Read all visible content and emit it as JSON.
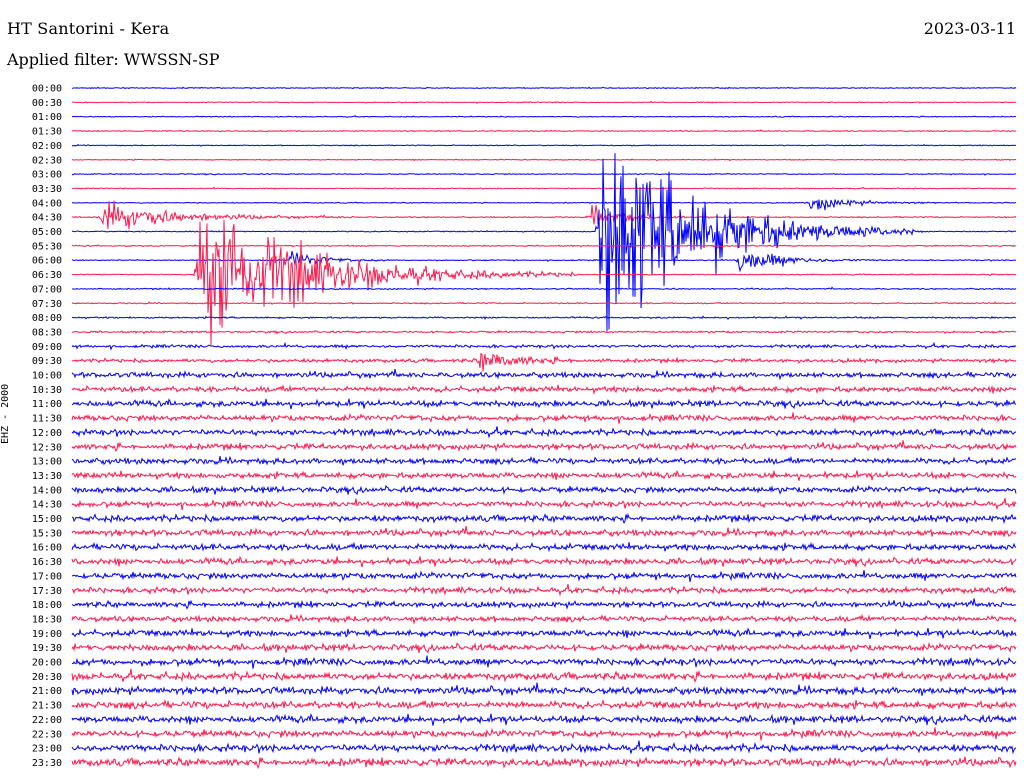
{
  "header": {
    "title": "HT Santorini - Kera",
    "date": "2023-03-11",
    "filter": "Applied filter: WWSSN-SP",
    "channel": "EHZ - 2000"
  },
  "colors": {
    "trace_a": "#0000ff",
    "trace_b": "#ff1a4d",
    "background": "#ffffff"
  },
  "chart_data": {
    "type": "line",
    "title": "HT Santorini - Kera",
    "ylabel": "EHZ - 2000",
    "grid": false,
    "rows": [
      "00:00",
      "00:30",
      "01:00",
      "01:30",
      "02:00",
      "02:30",
      "03:00",
      "03:30",
      "04:00",
      "04:30",
      "05:00",
      "05:30",
      "06:00",
      "06:30",
      "07:00",
      "07:30",
      "08:00",
      "08:30",
      "09:00",
      "09:30",
      "10:00",
      "10:30",
      "11:00",
      "11:30",
      "12:00",
      "12:30",
      "13:00",
      "13:30",
      "14:00",
      "14:30",
      "15:00",
      "15:30",
      "16:00",
      "16:30",
      "17:00",
      "17:30",
      "18:00",
      "18:30",
      "19:00",
      "19:30",
      "20:00",
      "20:30",
      "21:00",
      "21:30",
      "22:00",
      "22:30",
      "23:00",
      "23:30"
    ],
    "noise_level": [
      0.15,
      0.15,
      0.15,
      0.15,
      0.15,
      0.15,
      0.15,
      0.15,
      0.15,
      0.18,
      0.18,
      0.18,
      0.18,
      0.18,
      0.2,
      0.2,
      0.25,
      0.3,
      0.45,
      0.55,
      0.8,
      0.85,
      0.9,
      0.9,
      0.9,
      0.9,
      0.9,
      0.9,
      0.9,
      0.9,
      0.95,
      0.95,
      0.95,
      0.95,
      0.95,
      0.9,
      0.85,
      0.85,
      0.95,
      1.0,
      1.05,
      1.1,
      1.1,
      1.1,
      1.05,
      1.05,
      1.1,
      1.15
    ],
    "events": [
      {
        "row": "04:30",
        "minute": 1.0,
        "amplitude": 1.6,
        "duration_min": 2.0
      },
      {
        "row": "04:30",
        "minute": 16.5,
        "amplitude": 1.2,
        "duration_min": 1.0
      },
      {
        "row": "04:00",
        "minute": 23.5,
        "amplitude": 1.0,
        "duration_min": 1.0
      },
      {
        "row": "06:00",
        "minute": 7.0,
        "amplitude": 1.0,
        "duration_min": 0.8
      },
      {
        "row": "06:00",
        "minute": 21.2,
        "amplitude": 1.4,
        "duration_min": 1.2
      },
      {
        "row": "06:30",
        "minute": 4.0,
        "amplitude": 8.0,
        "duration_min": 3.0
      },
      {
        "row": "06:30",
        "minute": 4.5,
        "amplitude": 1.8,
        "duration_min": 1.0
      },
      {
        "row": "05:00",
        "minute": 16.8,
        "amplitude": 14.0,
        "duration_min": 2.5
      },
      {
        "row": "09:30",
        "minute": 13.0,
        "amplitude": 1.2,
        "duration_min": 1.0
      }
    ]
  }
}
